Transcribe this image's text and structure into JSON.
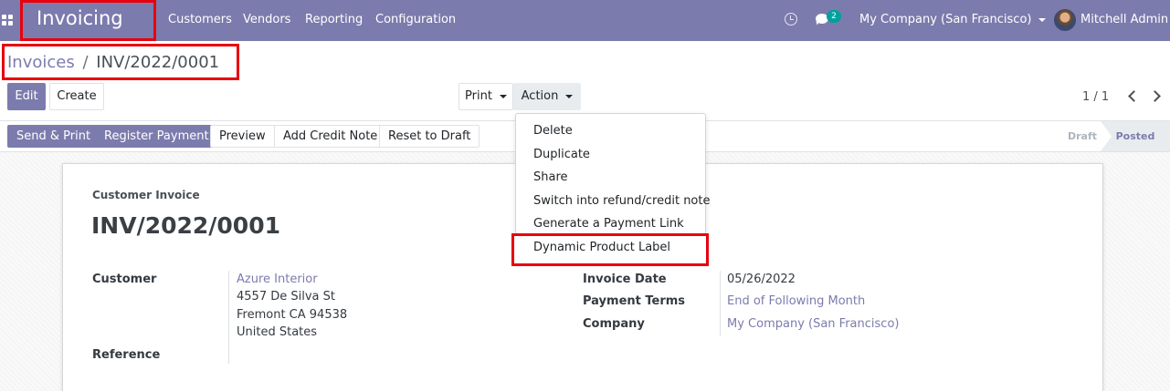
{
  "navbar": {
    "app_title": "Invoicing",
    "menu": [
      "Customers",
      "Vendors",
      "Reporting",
      "Configuration"
    ],
    "chat_count": "2",
    "company": "My Company (San Francisco)",
    "user": "Mitchell Admin",
    "color": "#7c7bad"
  },
  "breadcrumb": {
    "parent": "Invoices",
    "separator": "/",
    "current": "INV/2022/0001"
  },
  "controls": {
    "edit": "Edit",
    "create": "Create",
    "print": "Print",
    "action": "Action",
    "pager": "1 / 1"
  },
  "actions_menu": [
    "Delete",
    "Duplicate",
    "Share",
    "Switch into refund/credit note",
    "Generate a Payment Link",
    "Dynamic Product Label"
  ],
  "statusbar": {
    "buttons": [
      "Send & Print",
      "Register Payment",
      "Preview",
      "Add Credit Note",
      "Reset to Draft"
    ],
    "stages": [
      "Draft",
      "Posted"
    ],
    "current_stage": "Posted"
  },
  "invoice": {
    "type_label": "Customer Invoice",
    "number": "INV/2022/0001",
    "customer_label": "Customer",
    "customer_name": "Azure Interior",
    "address_line1": "4557 De Silva St",
    "address_line2": "Fremont CA 94538",
    "address_line3": "United States",
    "reference_label": "Reference",
    "invoice_date_label": "Invoice Date",
    "invoice_date": "05/26/2022",
    "payment_terms_label": "Payment Terms",
    "payment_terms": "End of Following Month",
    "company_label": "Company",
    "company": "My Company (San Francisco)"
  }
}
